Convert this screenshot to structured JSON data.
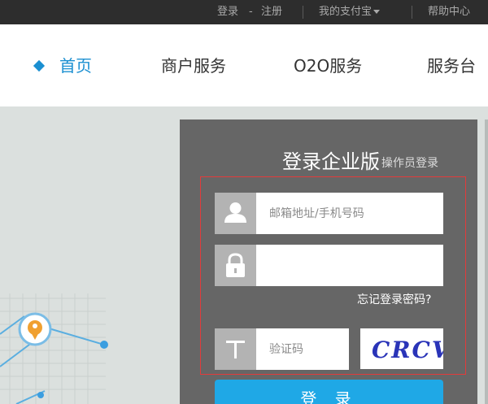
{
  "topbar": {
    "login": "登录",
    "dash": "-",
    "register": "注册",
    "my_alipay": "我的支付宝",
    "help": "帮助中心"
  },
  "nav": {
    "items": [
      {
        "label": "首页",
        "active": true
      },
      {
        "label": "商户服务",
        "active": false
      },
      {
        "label": "O2O服务",
        "active": false
      },
      {
        "label": "服务台",
        "active": false
      }
    ]
  },
  "login_panel": {
    "title": "登录企业版",
    "subtitle": "操作员登录",
    "username_placeholder": "邮箱地址/手机号码",
    "password_value": "",
    "forgot_link": "忘记登录密码?",
    "captcha_placeholder": "验证码",
    "captcha_text": "CRCV",
    "login_button": "登 录",
    "icons": [
      "user-icon",
      "lock-icon",
      "text-t-icon"
    ]
  },
  "colors": {
    "topbar_bg": "#2d2d2d",
    "accent_blue": "#1a8fd1",
    "panel_bg": "#666666",
    "highlight_border": "#e23b3b",
    "button_bg": "#1fa8e6"
  }
}
